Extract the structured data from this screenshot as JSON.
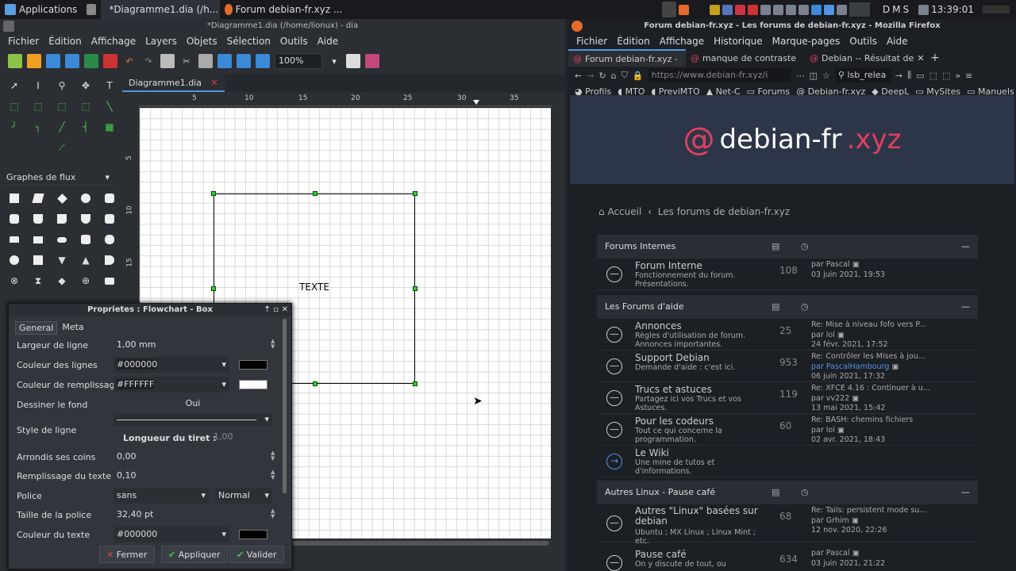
{
  "panel": {
    "apps_label": "Applications",
    "task1": "*Diagramme1.dia (/h...",
    "task2": "Forum debian-fr.xyz ...",
    "clock": "13:39:01",
    "kb1": "D",
    "kb2": "M",
    "kb3": "S"
  },
  "dia": {
    "title": "*Diagramme1.dia (/home/lionux) - dia",
    "menu": [
      "Fichier",
      "Édition",
      "Affichage",
      "Layers",
      "Objets",
      "Sélection",
      "Outils",
      "Aide"
    ],
    "zoom": "100%",
    "sheet": "Graphes de flux",
    "tab": "Diagramme1.dia",
    "ruler_h": [
      "5",
      "10",
      "15",
      "20",
      "25",
      "30",
      "35"
    ],
    "ruler_v": [
      "5",
      "10",
      "15"
    ],
    "box_text": "TEXTE"
  },
  "props": {
    "title": "Proprietes : Flowchart - Box",
    "tabs": [
      "General",
      "Meta"
    ],
    "rows": {
      "line_width_label": "Largeur de ligne",
      "line_width": "1,00 mm",
      "line_color_label": "Couleur des lignes",
      "line_color": "#000000",
      "fill_color_label": "Couleur de remplissage",
      "fill_color": "#FFFFFF",
      "draw_bg_label": "Dessiner le fond",
      "draw_bg": "Oui",
      "line_style_label": "Style de ligne",
      "dash_label": "Longueur du tiret :",
      "dash": "1,00",
      "corner_label": "Arrondis ses coins",
      "corner": "0,00",
      "padding_label": "Remplissage du texte",
      "padding": "0,10",
      "font_label": "Police",
      "font": "sans",
      "font_style": "Normal",
      "font_size_label": "Taille de la police",
      "font_size": "32,40 pt",
      "text_color_label": "Couleur du texte",
      "text_color": "#000000"
    },
    "buttons": {
      "close": "Fermer",
      "apply": "Appliquer",
      "ok": "Valider"
    }
  },
  "firefox": {
    "title": "Forum debian-fr.xyz - Les forums de debian-fr.xyz - Mozilla Firefox",
    "menu": [
      "Fichier",
      "Édition",
      "Affichage",
      "Historique",
      "Marque-pages",
      "Outils",
      "Aide"
    ],
    "tabs": [
      "Forum debian-fr.xyz -",
      "manque de contraste",
      "Debian -- Résultat de"
    ],
    "url": "https://www.debian-fr.xyz/i",
    "search": "lsb_relea",
    "bookmarks": [
      "Profils",
      "MTO",
      "PreviMTO",
      "Net-C",
      "Forums",
      "Debian-fr.xyz",
      "DeepL",
      "MySites",
      "Manuels"
    ],
    "logo_main": "debian-fr",
    "logo_tld": ".xyz",
    "breadcrumb_home": "Accueil",
    "breadcrumb_current": "Les forums de debian-fr.xyz",
    "sections": [
      {
        "title": "Forums Internes"
      },
      {
        "title": "Les Forums d'aide"
      },
      {
        "title": "Autres Linux - Pause café"
      }
    ],
    "forums": [
      {
        "title": "Forum Interne",
        "desc": "Fonctionnement du forum. Présentations.",
        "count": "108",
        "l1": "par Pascal",
        "l2": "03 juin 2021, 19:53"
      },
      {
        "title": "Annonces",
        "desc": "Règles d'utilisation de forum. Annonces importantes.",
        "count": "25",
        "l1": "Re: Mise à niveau fofo vers P...",
        "l2": "par lol",
        "l3": "24 févr. 2021, 17:52"
      },
      {
        "title": "Support Debian",
        "desc": "Demande d'aide : c'est ici.",
        "count": "953",
        "l1": "Re: Contrôler les Mises à jou...",
        "l2": "par PascalHambourg",
        "l3": "06 juin 2021, 17:32"
      },
      {
        "title": "Trucs et astuces",
        "desc": "Partagez ici vos Trucs et vos Astuces.",
        "count": "119",
        "l1": "Re: XFCE 4.16 : Continuer à u...",
        "l2": "par vv222",
        "l3": "13 mai 2021, 15:42"
      },
      {
        "title": "Pour les codeurs",
        "desc": "Tout ce qui concerne la programmation.",
        "count": "60",
        "l1": "Re: BASH: chemins fichiers",
        "l2": "par lol",
        "l3": "02 avr. 2021, 18:43"
      },
      {
        "title": "Le Wiki",
        "desc": "Une mine de tutos et d'informations.",
        "count": "",
        "l1": "",
        "l2": "",
        "l3": ""
      },
      {
        "title": "Autres \"Linux\" basées sur debian",
        "desc": "Ubuntu ; MX Linux ; Linux Mint ; etc.",
        "count": "68",
        "l1": "Re: Tails: persistent mode su...",
        "l2": "par Grhim",
        "l3": "12 nov. 2020, 22:26"
      },
      {
        "title": "Pause café",
        "desc": "On y discute de tout, ou",
        "count": "634",
        "l1": "par Pascal",
        "l2": "03 juin 2021, 21:22",
        "l3": ""
      }
    ]
  }
}
